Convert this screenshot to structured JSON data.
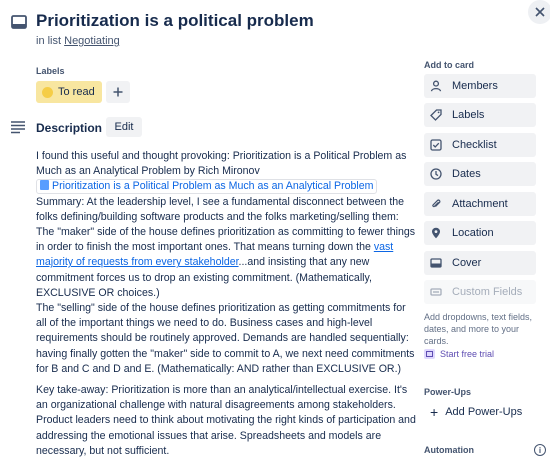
{
  "card": {
    "title": "Prioritization is a political problem",
    "list_prefix": "in list",
    "list_name": "Negotiating"
  },
  "labels": {
    "heading": "Labels",
    "items": [
      {
        "text": "To read",
        "color": "#f5cd47"
      }
    ]
  },
  "description": {
    "heading": "Description",
    "edit_label": "Edit",
    "intro": "I found this useful and thought provoking: Prioritization is a Political Problem as Much as an Analytical Problem by Rich Mironov",
    "smart_link": "Prioritization is a Political Problem as Much as an Analytical Problem",
    "summary_before": "Summary: At the leadership level, I see a fundamental disconnect between the folks defining/building software products and the folks marketing/selling them: The \"maker\" side of the house defines prioritization as committing to fewer things in order to finish the most important ones. That means turning down the ",
    "summary_link": "vast majority of requests from every stakeholder",
    "summary_after": "...and insisting that any new commitment forces us to drop an existing commitment. (Mathematically, EXCLUSIVE OR choices.)",
    "selling": "The \"selling\" side of the house defines prioritization as getting commitments for all of the important things we need to do. Business cases and high-level requirements should be routinely approved. Demands are handled sequentially: having finally gotten the \"maker\" side to commit to A, we next need commitments for B and C and D and E. (Mathematically: AND rather than EXCLUSIVE OR.)",
    "takeaway": "Key take-away: Prioritization is more than an analytical/intellectual exercise. It's an organizational challenge with natural disagreements among stakeholders. Product leaders need to think about motivating the right kinds of participation and addressing the emotional issues that arise. Spreadsheets and models are necessary, but not sufficient."
  },
  "sidebar": {
    "add_heading": "Add to card",
    "buttons": {
      "members": "Members",
      "labels": "Labels",
      "checklist": "Checklist",
      "dates": "Dates",
      "attachment": "Attachment",
      "location": "Location",
      "cover": "Cover",
      "custom_fields": "Custom Fields"
    },
    "note": "Add dropdowns, text fields, dates, and more to your cards.",
    "trial": "Start free trial",
    "powerups_heading": "Power-Ups",
    "add_powerups": "Add Power-Ups",
    "automation_heading": "Automation"
  },
  "colors": {
    "text": "#172b4d",
    "link": "#0c66e4",
    "label_bg": "#f8e6a0",
    "button_bg": "#f1f2f4"
  }
}
